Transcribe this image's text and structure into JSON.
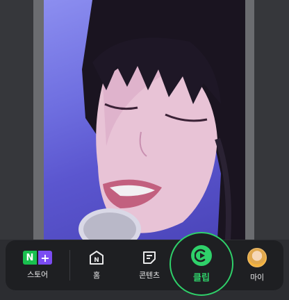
{
  "video": {
    "description_hidden": true
  },
  "nav": {
    "store_label": "스토어",
    "store_badge_n": "N",
    "store_badge_plus": "+",
    "home_label": "홈",
    "home_icon_letter": "N",
    "contents_label": "콘텐츠",
    "clip_label": "클립",
    "my_label": "마이"
  },
  "colors": {
    "accent_green": "#2fd16a",
    "store_green": "#19c04f",
    "store_purple": "#7b4cf2",
    "nav_bg": "#1e1f22"
  },
  "icons": [
    "store-icon",
    "home-icon",
    "contents-icon",
    "clip-icon",
    "avatar"
  ]
}
